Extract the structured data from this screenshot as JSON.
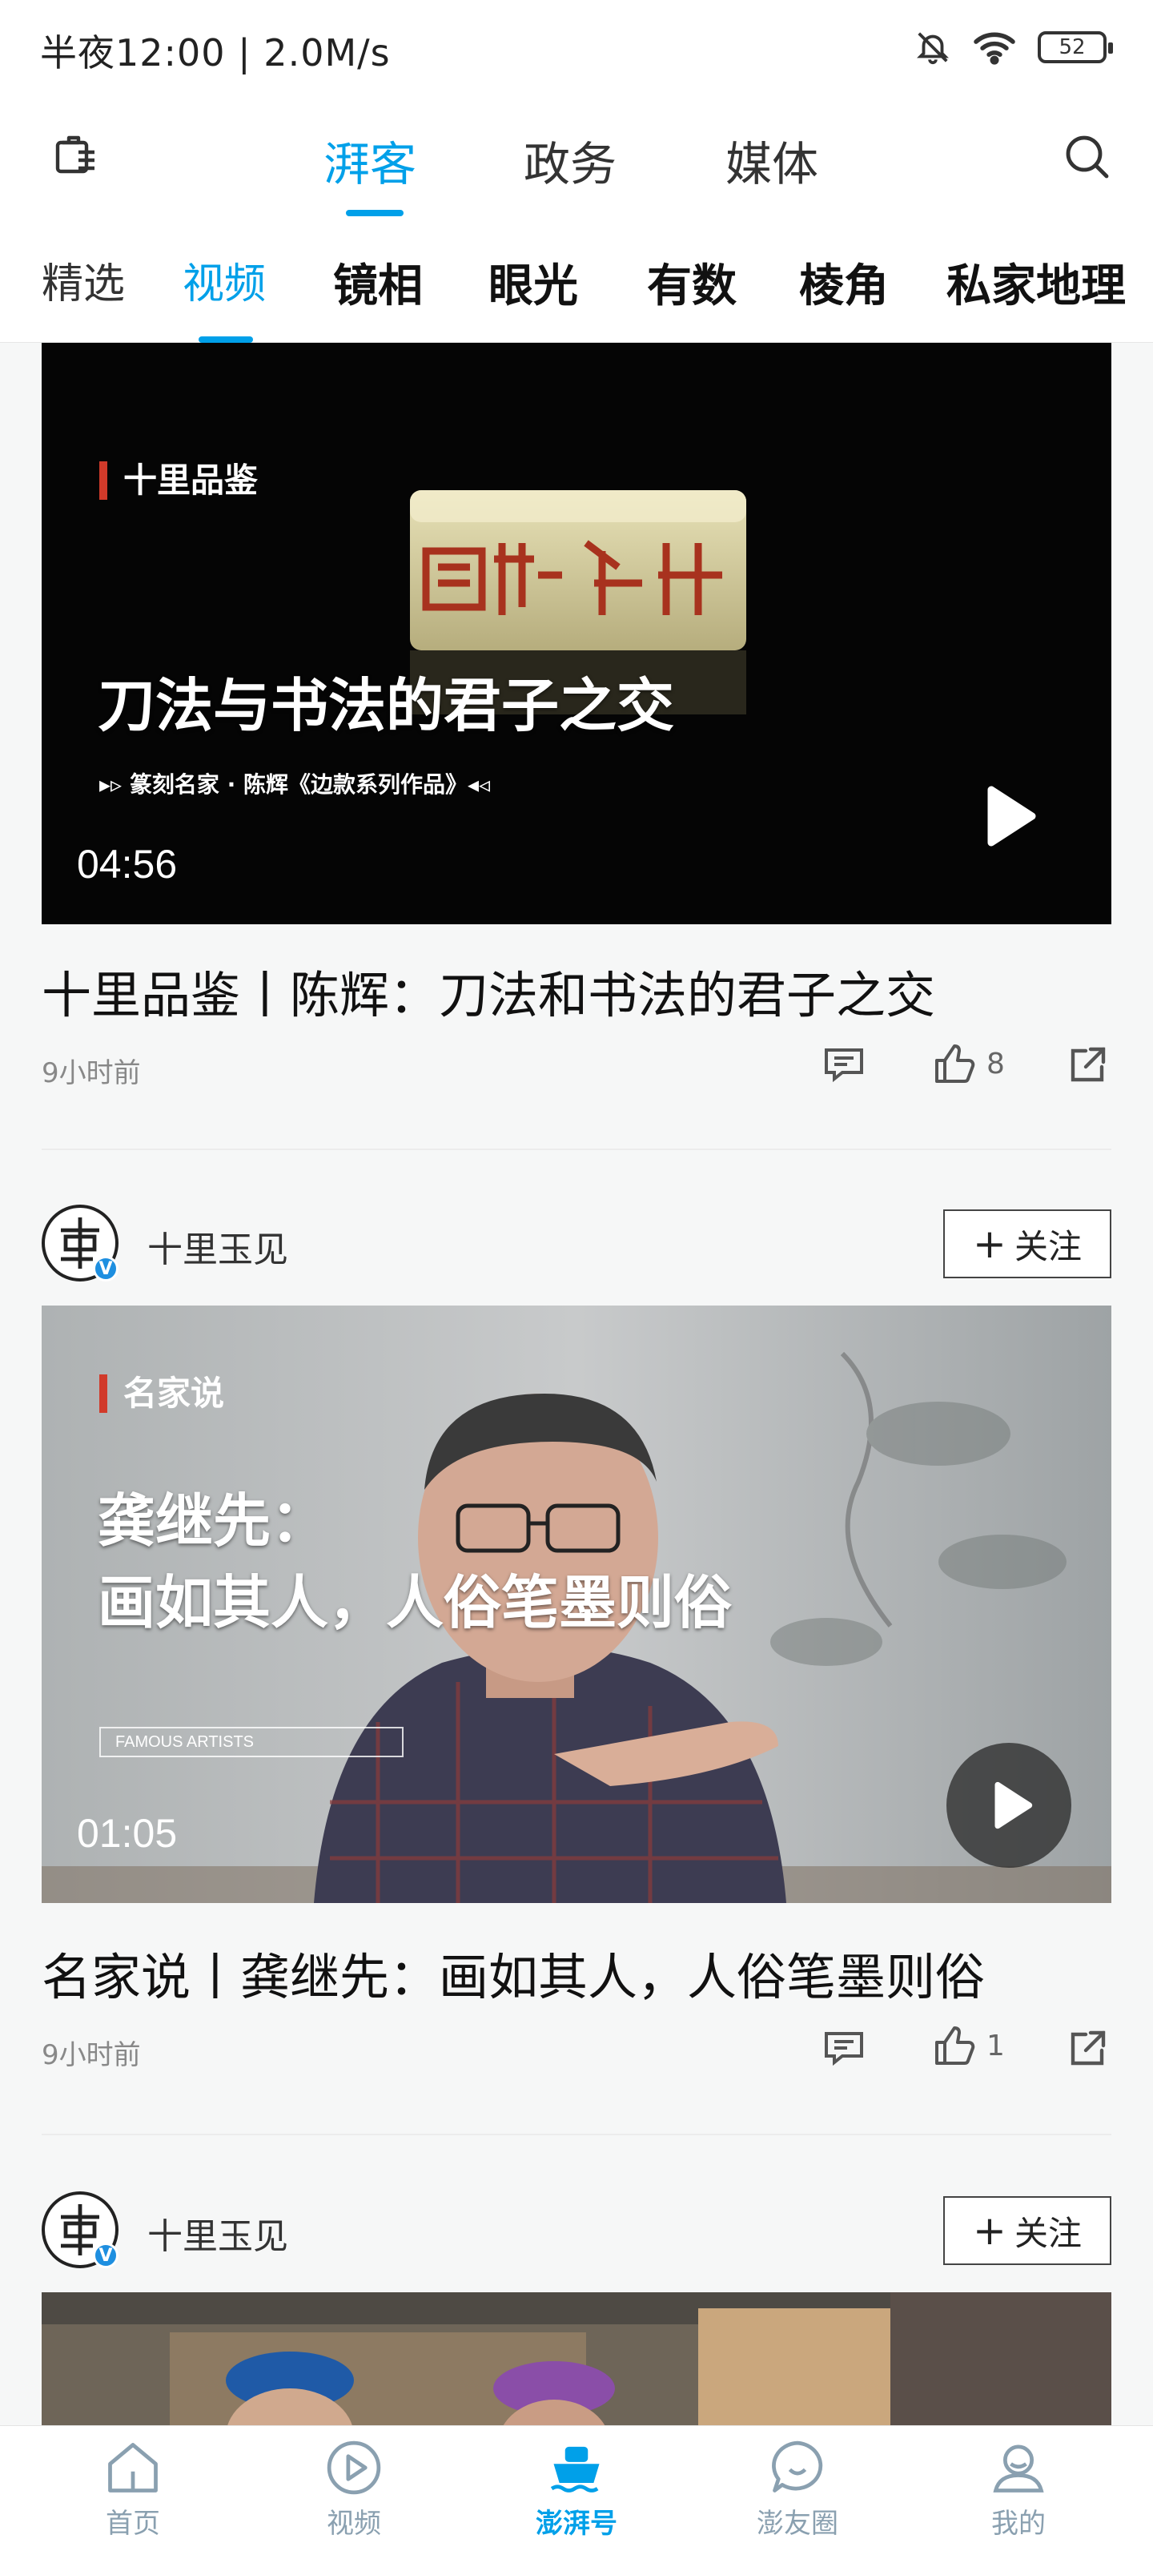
{
  "status_bar": {
    "text": "半夜12:00 | 2.0M/s",
    "battery": "52"
  },
  "top_nav": {
    "tabs": [
      {
        "label": "湃客",
        "active": true
      },
      {
        "label": "政务",
        "active": false
      },
      {
        "label": "媒体",
        "active": false
      }
    ]
  },
  "sub_nav": {
    "tabs": [
      {
        "label": "精选"
      },
      {
        "label": "视频"
      },
      {
        "label": "镜相"
      },
      {
        "label": "眼光"
      },
      {
        "label": "有数"
      },
      {
        "label": "棱角"
      },
      {
        "label": "私家地理"
      }
    ],
    "active": "视频"
  },
  "feed": {
    "items": [
      {
        "overlay_tag": "十里品鉴",
        "overlay_title": "刀法与书法的君子之交",
        "overlay_sub": "▸▹ 篆刻名家 · 陈辉《边款系列作品》◂◃",
        "duration": "04:56",
        "title": "十里品鉴丨陈辉：刀法和书法的君子之交",
        "time": "9小时前",
        "likes": "8"
      },
      {
        "author": "十里玉见",
        "follow_label": "关注",
        "overlay_tag": "名家说",
        "overlay_title_1": "龚继先：",
        "overlay_title_2": "画如其人，人俗笔墨则俗",
        "overlay_sub": "FAMOUS ARTISTS",
        "duration": "01:05",
        "title": "名家说丨龚继先：画如其人，人俗笔墨则俗",
        "time": "9小时前",
        "likes": "1"
      },
      {
        "author": "十里玉见",
        "follow_label": "关注"
      }
    ]
  },
  "bottom_nav": {
    "items": [
      {
        "label": "首页",
        "icon": "home-icon"
      },
      {
        "label": "视频",
        "icon": "video-icon"
      },
      {
        "label": "澎湃号",
        "icon": "boat-icon"
      },
      {
        "label": "澎友圈",
        "icon": "chat-icon"
      },
      {
        "label": "我的",
        "icon": "profile-icon"
      }
    ],
    "active": "澎湃号"
  },
  "colors": {
    "accent": "#00a0e9",
    "tag_red": "#d13a2a",
    "text": "#222222",
    "muted": "#888888"
  }
}
